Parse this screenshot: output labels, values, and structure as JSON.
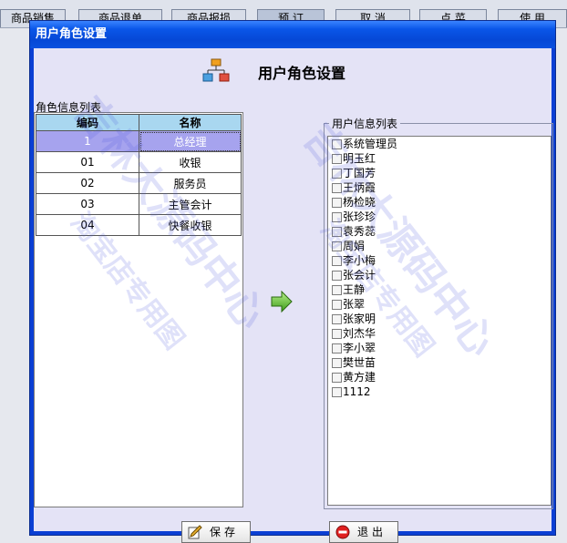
{
  "background_tabs": [
    "商品销售",
    "商品退单",
    "商品报损",
    "预 订",
    "取 消",
    "点 菜",
    "使 用"
  ],
  "dialog": {
    "title": "用户角色设置",
    "heading": "用户角色设置"
  },
  "roles": {
    "label": "角色信息列表",
    "columns": [
      "编码",
      "名称"
    ],
    "rows": [
      {
        "code": "1",
        "name": "总经理"
      },
      {
        "code": "01",
        "name": "收银"
      },
      {
        "code": "02",
        "name": "服务员"
      },
      {
        "code": "03",
        "name": "主管会计"
      },
      {
        "code": "04",
        "name": "快餐收银"
      }
    ]
  },
  "users": {
    "label": "用户信息列表",
    "items": [
      "系统管理员",
      "明玉红",
      "丁国芳",
      "王炳霞",
      "杨检晓",
      "张珍珍",
      "袁秀蕊",
      "周娟",
      "李小梅",
      "张会计",
      "王静",
      "张翠",
      "张家明",
      "刘杰华",
      "李小翠",
      "樊世苗",
      "黄方建",
      "1112"
    ]
  },
  "buttons": {
    "save": "保存",
    "exit": "退出"
  },
  "watermark": {
    "line1": "吉林大源码中心",
    "line2": "淘宝店专用图"
  },
  "colors": {
    "titlebar": "#0a56e8",
    "client_bg": "#e4e3f6",
    "header_bg": "#a9d7f0",
    "selected_row": "#a6a3ee"
  }
}
